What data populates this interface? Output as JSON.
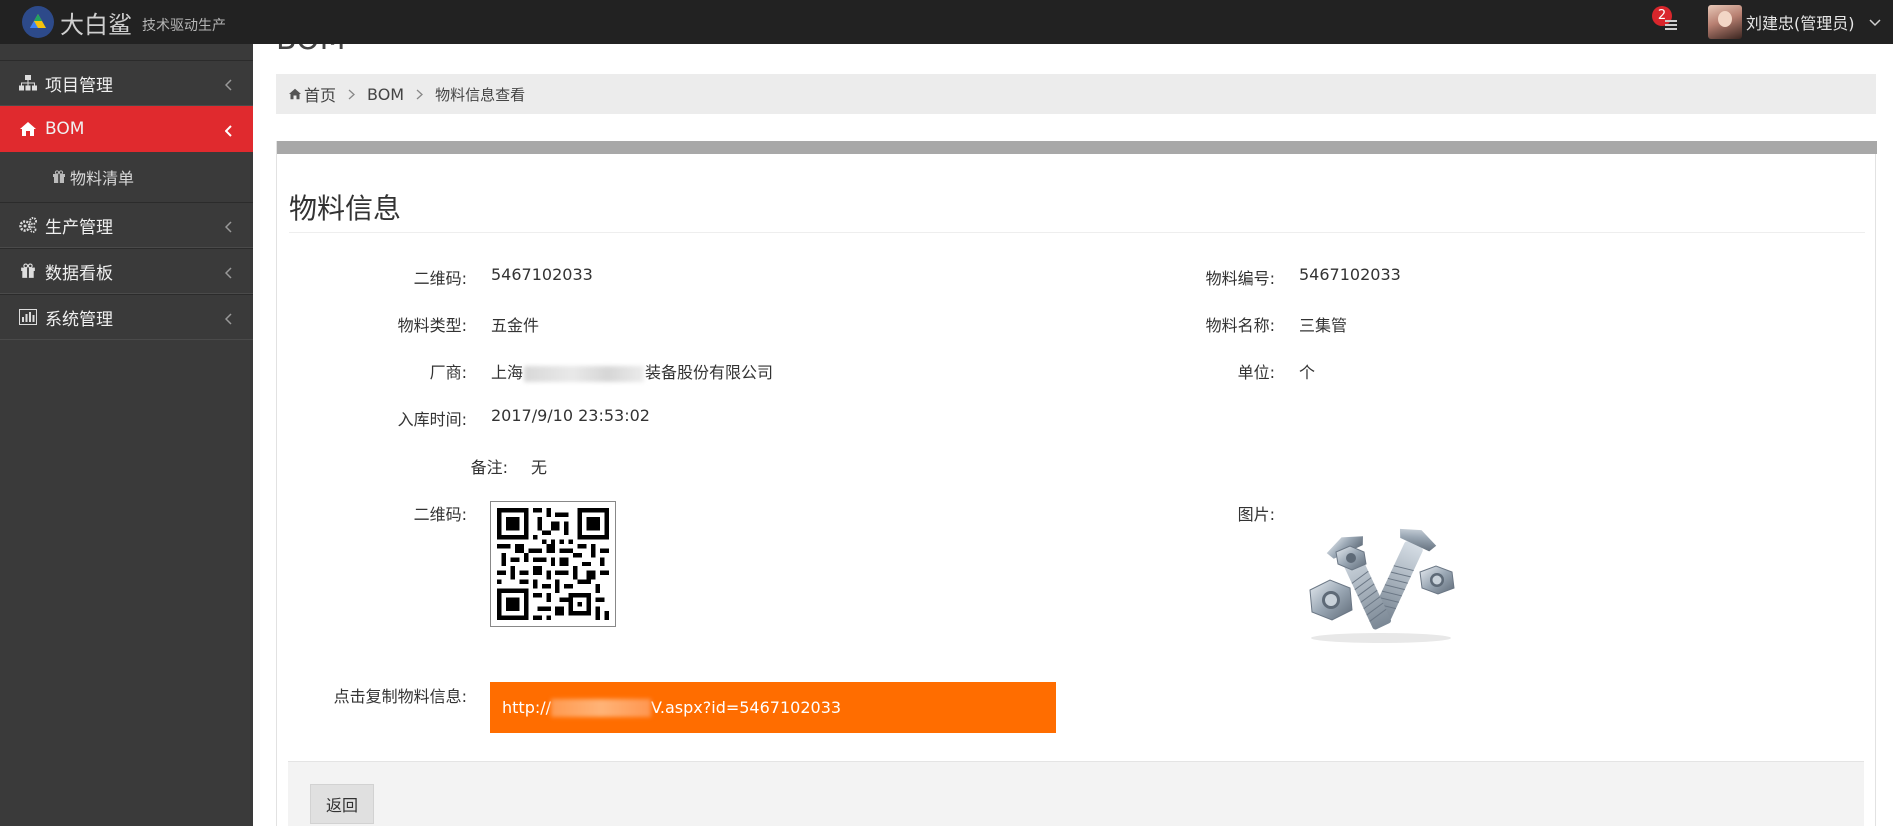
{
  "topbar": {
    "brand_name": "大白鲨",
    "brand_slogan": "技术驱动生产",
    "notification_count": "2",
    "user_name": "刘建忠(管理员)"
  },
  "sidebar": {
    "items": [
      {
        "label": "项目管理",
        "icon": "sitemap-icon"
      },
      {
        "label": "BOM",
        "icon": "home-icon",
        "active": true
      },
      {
        "label": "物料清单",
        "icon": "gift-icon",
        "sub": true
      },
      {
        "label": "生产管理",
        "icon": "gears-icon"
      },
      {
        "label": "数据看板",
        "icon": "gift-icon"
      },
      {
        "label": "系统管理",
        "icon": "bar-chart-icon"
      }
    ]
  },
  "page": {
    "heading": "BOM"
  },
  "breadcrumb": [
    "首页",
    "BOM",
    "物料信息查看"
  ],
  "panel": {
    "title": "物料信息",
    "fields": {
      "qrcode_label": "二维码:",
      "qrcode_value": "5467102033",
      "material_no_label": "物料编号:",
      "material_no_value": "5467102033",
      "material_type_label": "物料类型:",
      "material_type_value": "五金件",
      "material_name_label": "物料名称:",
      "material_name_value": "三集管",
      "vendor_label": "厂商:",
      "vendor_prefix": "上海",
      "vendor_suffix": "装备股份有限公司",
      "unit_label": "单位:",
      "unit_value": "个",
      "stock_time_label": "入库时间:",
      "stock_time_value": "2017/9/10 23:53:02",
      "remark_label": "备注:",
      "remark_value": "无",
      "qr_image_label": "二维码:",
      "picture_label": "图片:",
      "copy_label": "点击复制物料信息:",
      "copy_prefix": "http://",
      "copy_suffix": "V.aspx?id=5467102033"
    },
    "back_button": "返回"
  },
  "colors": {
    "topbar": "#222222",
    "sidebar": "#3a3a3a",
    "active": "#e02a2e",
    "copy_box": "#ff6d00",
    "badge": "#d9262c"
  }
}
